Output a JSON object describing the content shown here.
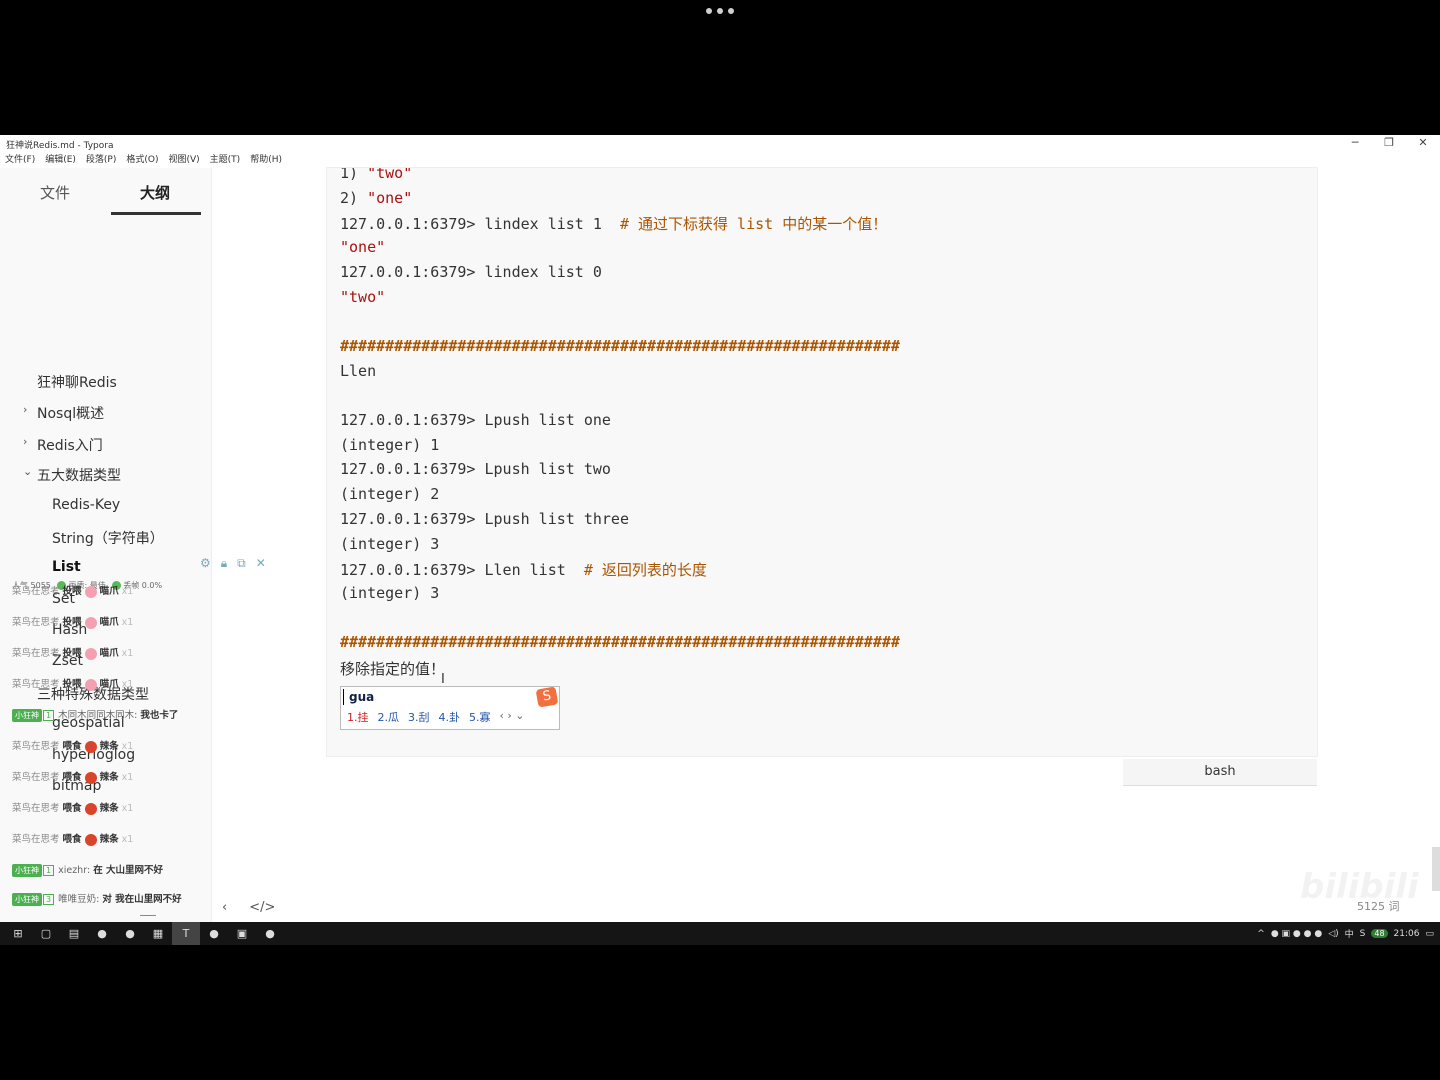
{
  "window": {
    "title": "狂神说Redis.md - Typora",
    "controls": {
      "minimize": "─",
      "restore": "❐",
      "close": "✕"
    }
  },
  "menu": [
    "文件(F)",
    "编辑(E)",
    "段落(P)",
    "格式(O)",
    "视图(V)",
    "主题(T)",
    "帮助(H)"
  ],
  "sidebar": {
    "tabs": {
      "file": "文件",
      "outline": "大纲"
    },
    "outline": [
      {
        "label": "狂神聊Redis",
        "level": 0,
        "arrow": ""
      },
      {
        "label": "Nosql概述",
        "level": 0,
        "arrow": "›"
      },
      {
        "label": "Redis入门",
        "level": 0,
        "arrow": "›"
      },
      {
        "label": "五大数据类型",
        "level": 0,
        "arrow": "⌄"
      },
      {
        "label": "Redis-Key",
        "level": 1,
        "arrow": ""
      },
      {
        "label": "String（字符串）",
        "level": 1,
        "arrow": ""
      },
      {
        "label": "List",
        "level": 1,
        "arrow": "",
        "active": true
      },
      {
        "label": "Set",
        "level": 1,
        "arrow": ""
      },
      {
        "label": "Hash",
        "level": 1,
        "arrow": ""
      },
      {
        "label": "Zset",
        "level": 1,
        "arrow": ""
      },
      {
        "label": "三种特殊数据类型",
        "level": 0,
        "arrow": ""
      },
      {
        "label": "geospatial",
        "level": 1,
        "arrow": ""
      },
      {
        "label": "hyperloglog",
        "level": 1,
        "arrow": ""
      },
      {
        "label": "bitmap",
        "level": 1,
        "arrow": ""
      }
    ],
    "bottom_icons": {
      "back": "‹",
      "source": "</>"
    }
  },
  "live_overlay": {
    "stats": {
      "popularity": "人气 5055",
      "quality": "画质: 最佳",
      "drop": "丢帧 0.0%"
    },
    "chat": [
      {
        "user": "菜鸟在思考",
        "action": "投喂",
        "gift": "喵爪",
        "count": "x1",
        "giftColor": "#f5a0b0"
      },
      {
        "user": "菜鸟在思考",
        "action": "投喂",
        "gift": "喵爪",
        "count": "x1",
        "giftColor": "#f5a0b0"
      },
      {
        "user": "菜鸟在思考",
        "action": "投喂",
        "gift": "喵爪",
        "count": "x1",
        "giftColor": "#f5a0b0"
      },
      {
        "user": "菜鸟在思考",
        "action": "投喂",
        "gift": "喵爪",
        "count": "x1",
        "giftColor": "#f5a0b0"
      },
      {
        "badge": "小狂神",
        "level": "1",
        "user": "木同木同同木同木:",
        "message": "我也卡了"
      },
      {
        "user": "菜鸟在思考",
        "action": "喂食",
        "gift": "辣条",
        "count": "x1",
        "giftColor": "#d9442a"
      },
      {
        "user": "菜鸟在思考",
        "action": "喂食",
        "gift": "辣条",
        "count": "x1",
        "giftColor": "#d9442a"
      },
      {
        "user": "菜鸟在思考",
        "action": "喂食",
        "gift": "辣条",
        "count": "x1",
        "giftColor": "#d9442a"
      },
      {
        "user": "菜鸟在思考",
        "action": "喂食",
        "gift": "辣条",
        "count": "x1",
        "giftColor": "#d9442a"
      },
      {
        "badge": "小狂神",
        "level": "1",
        "user": "xiezhr:",
        "message": "在 大山里网不好"
      },
      {
        "badge": "小狂神",
        "level": "3",
        "user": "唯唯豆奶:",
        "message": "对 我在山里网不好"
      }
    ]
  },
  "code": {
    "language": "bash",
    "lines": [
      [
        {
          "t": "1) ",
          "c": ""
        },
        {
          "t": "\"two\"",
          "c": "str"
        }
      ],
      [
        {
          "t": "2) ",
          "c": ""
        },
        {
          "t": "\"one\"",
          "c": "str"
        }
      ],
      [
        {
          "t": "127.0.0.1:6379> lindex list 1  ",
          "c": ""
        },
        {
          "t": "# 通过下标获得 list 中的某一个值！",
          "c": "cmt"
        }
      ],
      [
        {
          "t": "\"one\"",
          "c": "str"
        }
      ],
      [
        {
          "t": "127.0.0.1:6379> lindex list 0",
          "c": ""
        }
      ],
      [
        {
          "t": "\"two\"",
          "c": "str"
        }
      ],
      [],
      [
        {
          "t": "##############################################################",
          "c": "hash"
        }
      ],
      [
        {
          "t": "Llen",
          "c": ""
        }
      ],
      [],
      [
        {
          "t": "127.0.0.1:6379> Lpush list one",
          "c": ""
        }
      ],
      [
        {
          "t": "(integer) 1",
          "c": ""
        }
      ],
      [
        {
          "t": "127.0.0.1:6379> Lpush list two",
          "c": ""
        }
      ],
      [
        {
          "t": "(integer) 2",
          "c": ""
        }
      ],
      [
        {
          "t": "127.0.0.1:6379> Lpush list three",
          "c": ""
        }
      ],
      [
        {
          "t": "(integer) 3",
          "c": ""
        }
      ],
      [
        {
          "t": "127.0.0.1:6379> Llen list  ",
          "c": ""
        },
        {
          "t": "# 返回列表的长度",
          "c": "cmt"
        }
      ],
      [
        {
          "t": "(integer) 3",
          "c": ""
        }
      ],
      [],
      [
        {
          "t": "##############################################################",
          "c": "hash"
        }
      ],
      [
        {
          "t": "移除指定的值！",
          "c": "cn"
        }
      ]
    ]
  },
  "ime": {
    "input": "gua",
    "candidates": [
      "1.挂",
      "2.瓜",
      "3.刮",
      "4.卦",
      "5.寡"
    ],
    "nav": "‹ › ⌄",
    "logo": "S"
  },
  "status": {
    "word_count": "5125 词"
  },
  "taskbar": {
    "time": "21:06",
    "ime_lang": "中",
    "badge": "48",
    "apps": [
      "⊞",
      "▢",
      "▤",
      "●",
      "●",
      "▦",
      "T",
      "●",
      "▣",
      "●"
    ]
  }
}
